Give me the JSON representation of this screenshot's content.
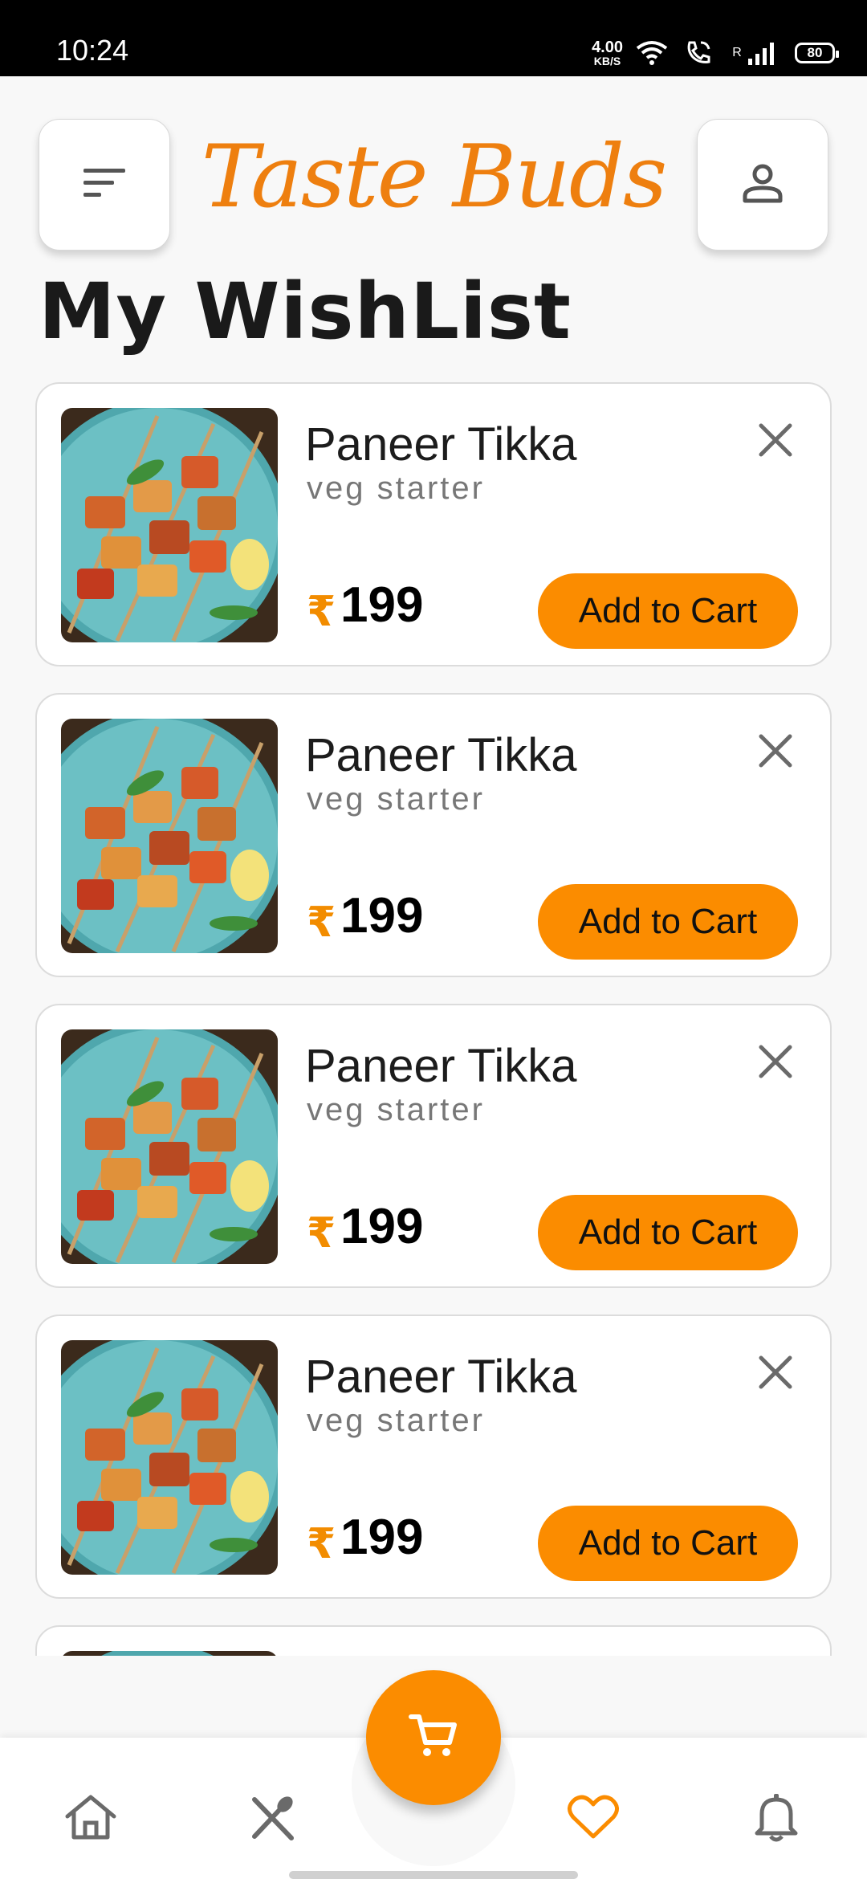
{
  "status_bar": {
    "time": "10:24",
    "net_speed_value": "4.00",
    "net_speed_unit": "KB/S",
    "network_label": "R",
    "battery": "80",
    "icons": [
      "wifi-icon",
      "wifi-call-icon",
      "signal-icon",
      "battery-icon"
    ]
  },
  "header": {
    "brand": "Taste Buds",
    "menu_icon": "sort-menu-icon",
    "profile_icon": "person-icon"
  },
  "page": {
    "title": "My WishList"
  },
  "wishlist": {
    "items": [
      {
        "name": "Paneer Tikka",
        "category": "veg starter",
        "currency": "₹",
        "price": "199",
        "button": "Add to Cart"
      },
      {
        "name": "Paneer Tikka",
        "category": "veg starter",
        "currency": "₹",
        "price": "199",
        "button": "Add to Cart"
      },
      {
        "name": "Paneer Tikka",
        "category": "veg starter",
        "currency": "₹",
        "price": "199",
        "button": "Add to Cart"
      },
      {
        "name": "Paneer Tikka",
        "category": "veg starter",
        "currency": "₹",
        "price": "199",
        "button": "Add to Cart"
      },
      {
        "name": "",
        "category": "",
        "currency": "",
        "price": "",
        "button": ""
      }
    ]
  },
  "bottom_nav": {
    "items": [
      {
        "icon": "home-icon",
        "active": false
      },
      {
        "icon": "fork-spoon-icon",
        "active": false
      },
      {
        "icon": "heart-icon",
        "active": true
      },
      {
        "icon": "bell-icon",
        "active": false
      }
    ],
    "fab_icon": "cart-icon"
  },
  "colors": {
    "accent": "#fb8c00",
    "brand": "#ee7f0f",
    "inactive_icon": "#6a6a6a",
    "background": "#f8f8f8"
  }
}
